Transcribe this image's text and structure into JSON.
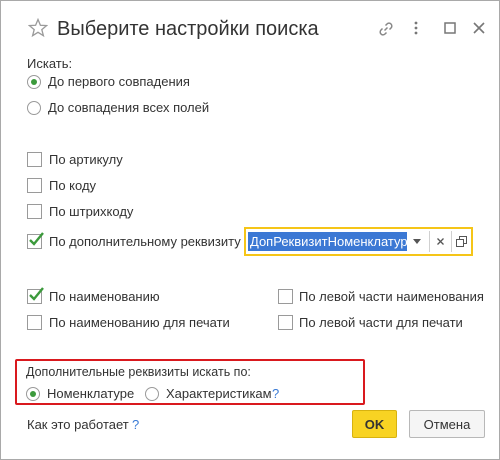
{
  "window": {
    "title": "Выберите настройки поиска"
  },
  "search_section": {
    "label": "Искать:",
    "options": [
      {
        "label": "До первого совпадения",
        "selected": true
      },
      {
        "label": "До совпадения всех полей",
        "selected": false
      }
    ]
  },
  "checkboxes": {
    "by_article": {
      "label": "По артикулу",
      "checked": false
    },
    "by_code": {
      "label": "По коду",
      "checked": false
    },
    "by_barcode": {
      "label": "По штрихкоду",
      "checked": false
    },
    "by_extra_attr": {
      "label": "По дополнительному реквизиту",
      "checked": true
    },
    "by_name": {
      "label": "По наименованию",
      "checked": true
    },
    "by_left_name": {
      "label": "По левой части наименования",
      "checked": false
    },
    "by_print_name": {
      "label": "По наименованию для печати",
      "checked": false
    },
    "by_left_print": {
      "label": "По левой части для печати",
      "checked": false
    }
  },
  "extra_attr_field": {
    "value": "ДопРеквизитНоменклатура"
  },
  "extra_attrs_group": {
    "label": "Дополнительные реквизиты искать по:",
    "options": [
      {
        "label": "Номенклатуре",
        "selected": true
      },
      {
        "label": "Характеристикам",
        "selected": false
      }
    ],
    "help": "?"
  },
  "footer": {
    "how_it_works": "Как это работает",
    "help": "?",
    "ok_label": "OK",
    "cancel_label": "Отмена"
  },
  "colors": {
    "accent_green": "#3c9a3c",
    "ok_button": "#f8d323",
    "highlight_border": "#d9191e",
    "field_focus": "#f5c518",
    "selection": "#3b78d4"
  }
}
